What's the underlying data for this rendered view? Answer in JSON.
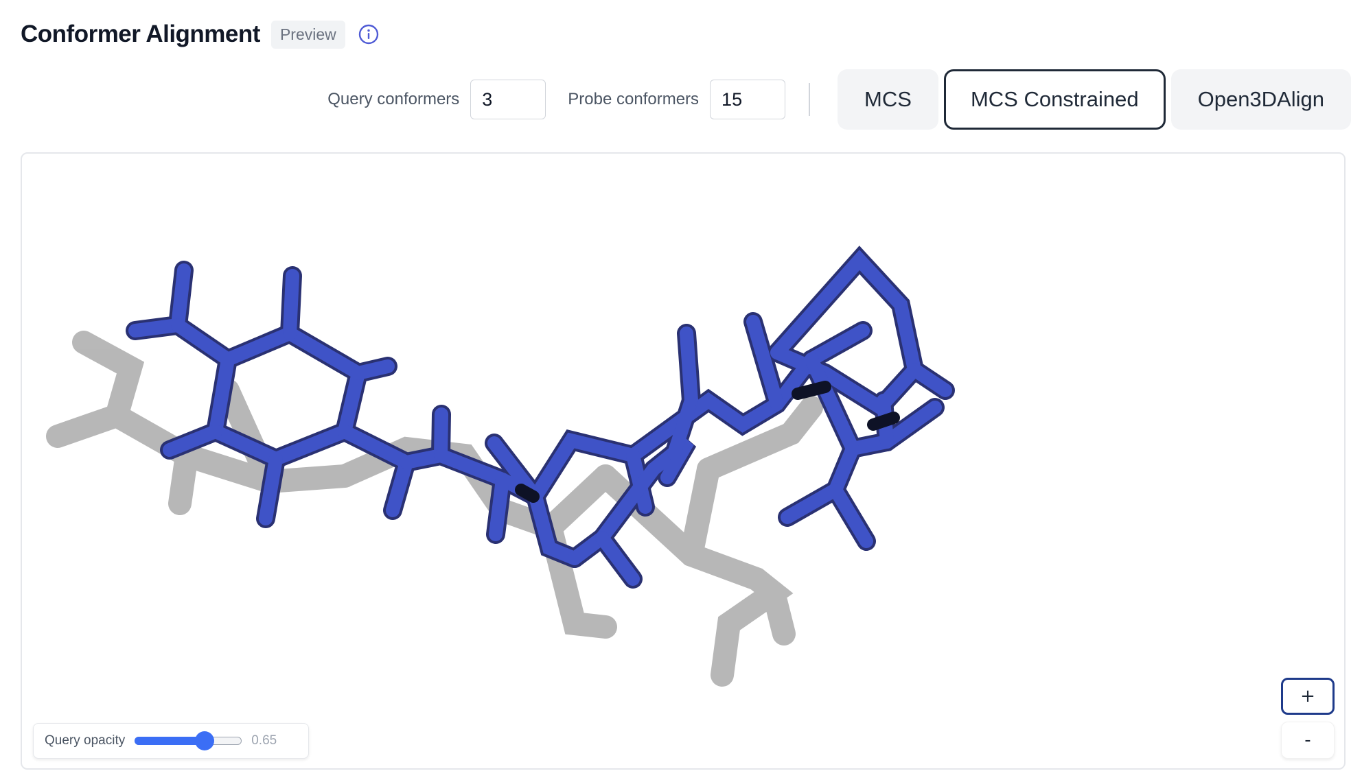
{
  "header": {
    "title": "Conformer Alignment",
    "badge": "Preview",
    "info_icon": "info-icon"
  },
  "controls": {
    "query_label": "Query conformers",
    "query_value": "3",
    "probe_label": "Probe conformers",
    "probe_value": "15",
    "modes": [
      {
        "label": "MCS",
        "active": false
      },
      {
        "label": "MCS Constrained",
        "active": true
      },
      {
        "label": "Open3DAlign",
        "active": false
      }
    ]
  },
  "viewer": {
    "opacity_label": "Query opacity",
    "opacity_value": 0.65,
    "opacity_display": "0.65",
    "zoom_in_label": "+",
    "zoom_out_label": "-",
    "colors": {
      "probe": "#3f53c7",
      "probe_shade": "#2a3172",
      "probe_dark": "#0e1226",
      "query": "#9a9a9a",
      "accent": "#3b6ef5"
    }
  }
}
